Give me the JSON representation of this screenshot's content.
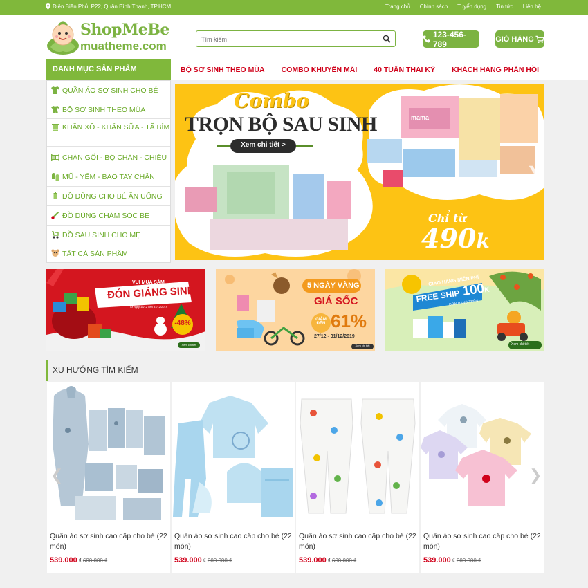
{
  "topbar": {
    "address": "Điện Biên Phủ, P22, Quận Bình Thạnh, TP.HCM",
    "links": [
      "Trang chủ",
      "Chính sách",
      "Tuyển dụng",
      "Tin tức",
      "Liên hệ"
    ]
  },
  "header": {
    "logo_line1": "ShopMeBe",
    "logo_line2": "muatheme.com",
    "search_placeholder": "Tìm kiếm",
    "phone": "123-456-789",
    "cart_label": "GIỎ HÀNG"
  },
  "category_title": "DANH MỤC SẢN PHẨM",
  "menu": [
    "BỘ SƠ SINH THEO MÙA",
    "COMBO KHUYẾN MÃI",
    "40 TUẦN THAI KỲ",
    "KHÁCH HÀNG PHẢN HỒI"
  ],
  "sidebar": [
    {
      "label": "QUẦN ÁO SƠ SINH CHO BÉ",
      "icon": "shirt-icon"
    },
    {
      "label": "BỘ SƠ SINH THEO MÙA",
      "icon": "baby-suit-icon"
    },
    {
      "label": "KHĂN XÔ - KHĂN SỮA - TÃ BỈM",
      "icon": "towel-icon"
    },
    {
      "label": "CHĂN GỐI - BỘ CHĂN - CHIẾU",
      "icon": "crib-icon"
    },
    {
      "label": "MŨ - YẾM - BAO TAY CHÂN",
      "icon": "mittens-icon"
    },
    {
      "label": "ĐỒ DÙNG CHO BÉ ĂN UỐNG",
      "icon": "bottle-icon"
    },
    {
      "label": "ĐỒ DÙNG CHĂM SÓC BÉ",
      "icon": "thermometer-icon"
    },
    {
      "label": "ĐỒ SAU SINH CHO MẸ",
      "icon": "stroller-icon"
    },
    {
      "label": "TẤT CẢ SẢN PHẨM",
      "icon": "bear-icon"
    }
  ],
  "banner": {
    "line1": "Combo",
    "line2": "TRỌN BỘ SAU SINH",
    "button": "Xem chi tiết >",
    "from": "Chỉ từ",
    "price": "490",
    "price_unit": "k",
    "pack_label": "mama"
  },
  "promos": [
    {
      "small": "VUI MUA SẮM",
      "title": "ĐÓN GIÁNG SINH",
      "sale": "-48%",
      "date": "Từ ngày 18/12 đến 31/12/2019",
      "btn": "Xem chi tiết"
    },
    {
      "line1": "5 NGÀY VÀNG",
      "line2": "GIÁ SỐC",
      "giam": "GIẢM ĐẾN",
      "pct": "61%",
      "date": "27/12 - 31/12/2019",
      "btn": "Xem chi tiết"
    },
    {
      "line1": "GIAO HÀNG MIỄN PHÍ",
      "line2": "FREE SHIP",
      "amount": "100",
      "unit": "K",
      "line3": "ĐƠN HÀNG TRÊN",
      "btn": "Xem chi tiết"
    }
  ],
  "section_title": "XU HƯỚNG TÌM KIẾM",
  "products": [
    {
      "name": "Quần áo sơ sinh cao cấp cho bé (22 món)",
      "price": "539.000",
      "currency": "₫",
      "old_price": "600.000 ₫"
    },
    {
      "name": "Quần áo sơ sinh cao cấp cho bé (22 món)",
      "price": "539.000",
      "currency": "₫",
      "old_price": "600.000 ₫"
    },
    {
      "name": "Quần áo sơ sinh cao cấp cho bé (22 món)",
      "price": "539.000",
      "currency": "₫",
      "old_price": "600.000 ₫"
    },
    {
      "name": "Quần áo sơ sinh cao cấp cho bé (22 món)",
      "price": "539.000",
      "currency": "₫",
      "old_price": "600.000 ₫"
    }
  ],
  "colors": {
    "brand_green": "#80b83b",
    "accent_red": "#d0021b",
    "banner_yellow": "#fdc314"
  }
}
